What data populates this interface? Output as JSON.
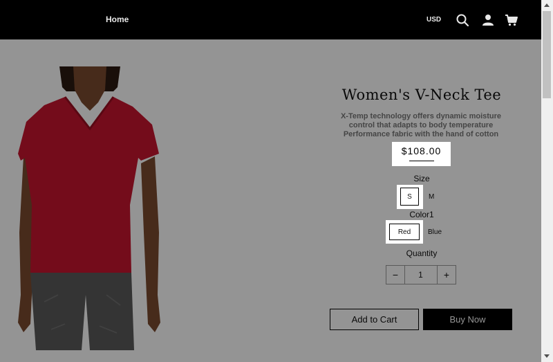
{
  "header": {
    "nav_home": "Home",
    "currency": "USD",
    "icons": [
      "search-icon",
      "user-icon",
      "cart-icon"
    ]
  },
  "product": {
    "title": "Women's V-Neck Tee",
    "description": [
      "X-Temp technology offers dynamic moisture",
      "control that adapts to body temperature",
      "Performance fabric with the hand of cotton"
    ],
    "price": "$108.00",
    "size": {
      "label": "Size",
      "options": [
        "S",
        "M"
      ],
      "selected": "S"
    },
    "color": {
      "label": "Color1",
      "options": [
        "Red",
        "Blue"
      ],
      "selected": "Red"
    },
    "quantity": {
      "label": "Quantity",
      "value": "1",
      "minus": "−",
      "plus": "+"
    },
    "add_to_cart": "Add to Cart",
    "buy_now": "Buy Now"
  },
  "colors": {
    "header_bg": "#000000",
    "shirt": "#c8152f",
    "overlay": "rgba(0,0,0,0.42)"
  }
}
